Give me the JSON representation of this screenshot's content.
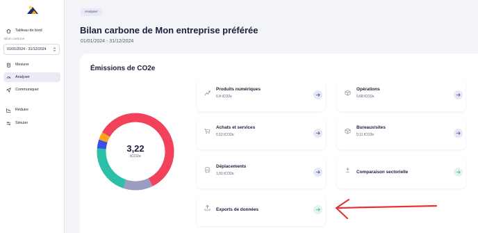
{
  "sidebar": {
    "items": [
      {
        "label": "Tableau de bord",
        "icon": "home-icon"
      },
      {
        "label": "Mesurer",
        "icon": "clipboard-icon"
      },
      {
        "label": "Analyser",
        "icon": "gauge-icon"
      },
      {
        "label": "Communiquer",
        "icon": "send-icon"
      },
      {
        "label": "Réduire",
        "icon": "chart-down-icon"
      },
      {
        "label": "Simuler",
        "icon": "sliders-icon"
      }
    ],
    "section_label": "Bilan carbone",
    "date_range": "01/01/2024 - 31/12/2024"
  },
  "header": {
    "badge": "Analyser",
    "title": "Bilan carbone de Mon entreprise préférée",
    "period": "01/01/2024 - 31/12/2024"
  },
  "emissions": {
    "title": "Émissions de CO2e",
    "total": "3,22",
    "unit": "tCO2e"
  },
  "chart_data": {
    "type": "pie",
    "segments": [
      {
        "value": 1.91,
        "color": "#f2415b"
      },
      {
        "value": 0.4,
        "color": "#9a9cc2"
      },
      {
        "value": 0.68,
        "color": "#2bbfa8"
      },
      {
        "value": 0.12,
        "color": "#3b4fe4"
      },
      {
        "value": 0.11,
        "color": "#f6a623"
      }
    ]
  },
  "tiles": [
    {
      "title": "Produits numériques",
      "value": "0,4 tCO2e",
      "icon": "digital-icon"
    },
    {
      "title": "Opérations",
      "value": "0,68 tCO2e",
      "icon": "cube-icon"
    },
    {
      "title": "Achats et services",
      "value": "0,12 tCO2e",
      "icon": "cart-icon"
    },
    {
      "title": "Bureaux/sites",
      "value": "0,11 tCO2e",
      "icon": "building-icon"
    },
    {
      "title": "Déplacements",
      "value": "1,91 tCO2e",
      "icon": "bus-icon"
    },
    {
      "title": "Comparaison sectorielle",
      "icon": "plus-minus-icon"
    },
    {
      "title": "Exports de données",
      "icon": "upload-icon"
    }
  ],
  "colors": {
    "annotation": "#e5333a",
    "accent": "#4a4d9e",
    "green": "#2bbf8c"
  }
}
